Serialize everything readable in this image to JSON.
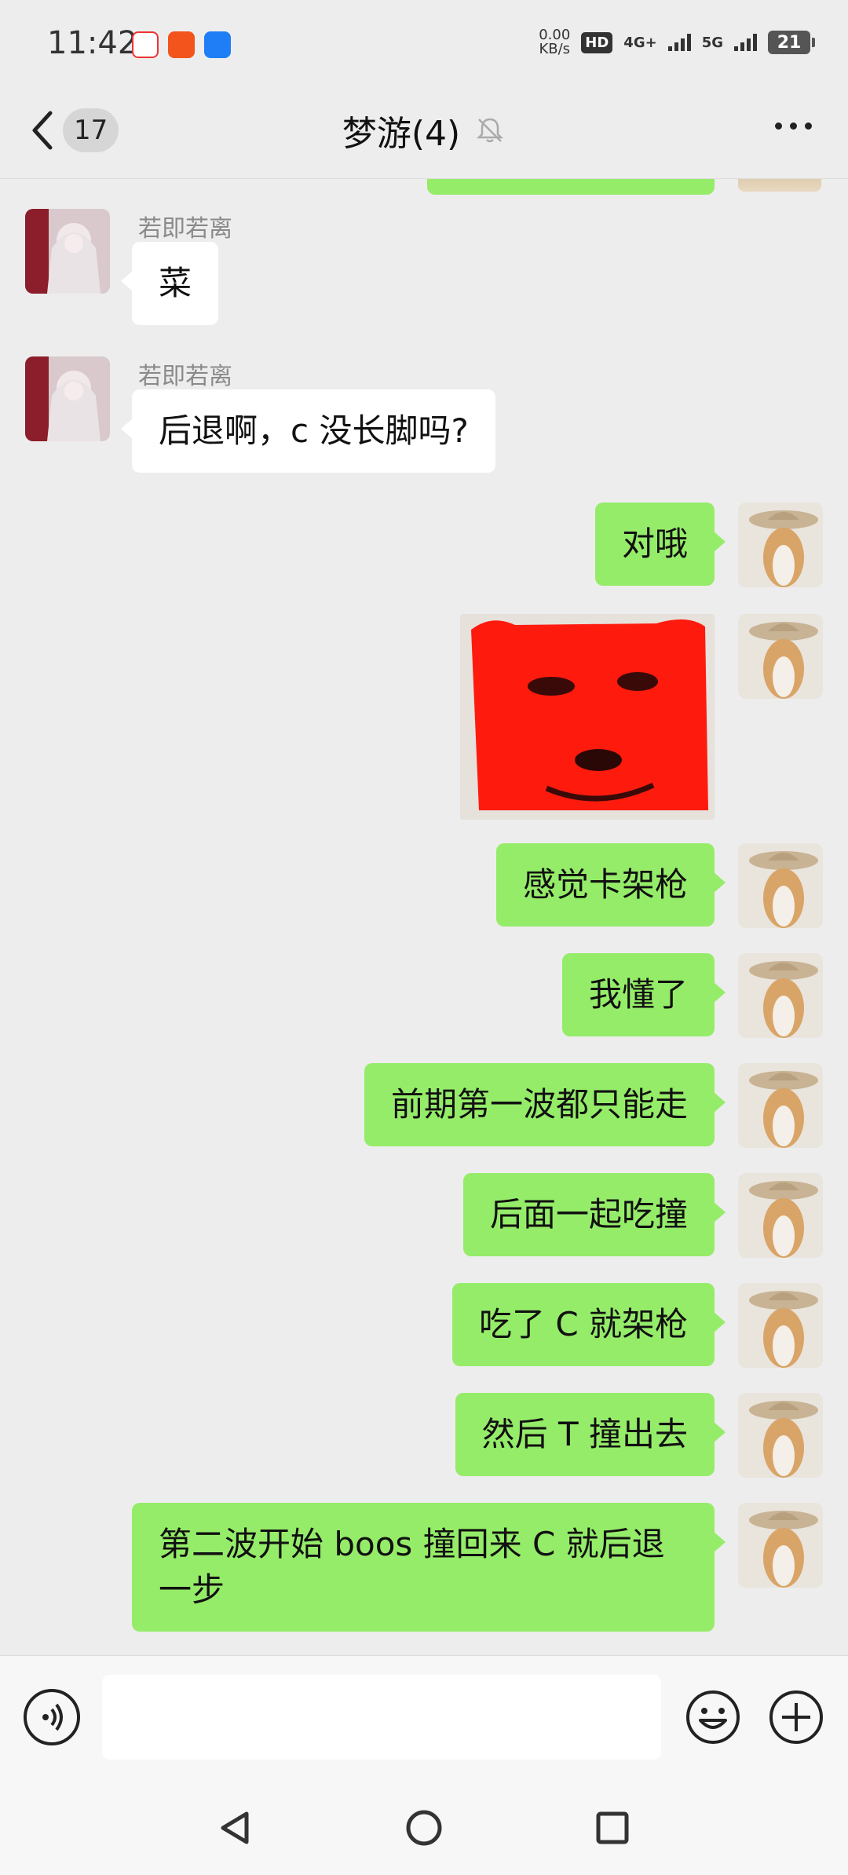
{
  "status_bar": {
    "time": "11:42",
    "net_speed_value": "0.00",
    "net_speed_unit": "KB/s",
    "hd_label": "HD",
    "sim1_label": "4G+",
    "sim2_label": "5G",
    "battery_level": "21",
    "app_icons": [
      "map-app-icon",
      "shopping-app-icon",
      "cloud-app-icon"
    ]
  },
  "header": {
    "back_count": "17",
    "title": "梦游(4)",
    "mute_icon": "bell-muted-icon",
    "more_icon": "more-dots-icon"
  },
  "messages": [
    {
      "direction": "in",
      "sender": "若即若离",
      "text": "菜"
    },
    {
      "direction": "in",
      "sender": "若即若离",
      "text": "后退啊，c 没长脚吗?"
    },
    {
      "direction": "out",
      "text": "对哦"
    },
    {
      "direction": "out",
      "type": "sticker",
      "sticker": "red-face-sticker"
    },
    {
      "direction": "out",
      "text": "感觉卡架枪"
    },
    {
      "direction": "out",
      "text": "我懂了"
    },
    {
      "direction": "out",
      "text": "前期第一波都只能走"
    },
    {
      "direction": "out",
      "text": "后面一起吃撞"
    },
    {
      "direction": "out",
      "text": "吃了 C 就架枪"
    },
    {
      "direction": "out",
      "text": "然后 T 撞出去"
    },
    {
      "direction": "out",
      "text": "第二波开始 boos 撞回来 C 就后退\n一步"
    }
  ],
  "input": {
    "value": "",
    "placeholder": ""
  },
  "colors": {
    "background": "#ededed",
    "outgoing_bubble": "#95ec69",
    "incoming_bubble": "#ffffff",
    "sender_name": "#8a8a8a"
  }
}
